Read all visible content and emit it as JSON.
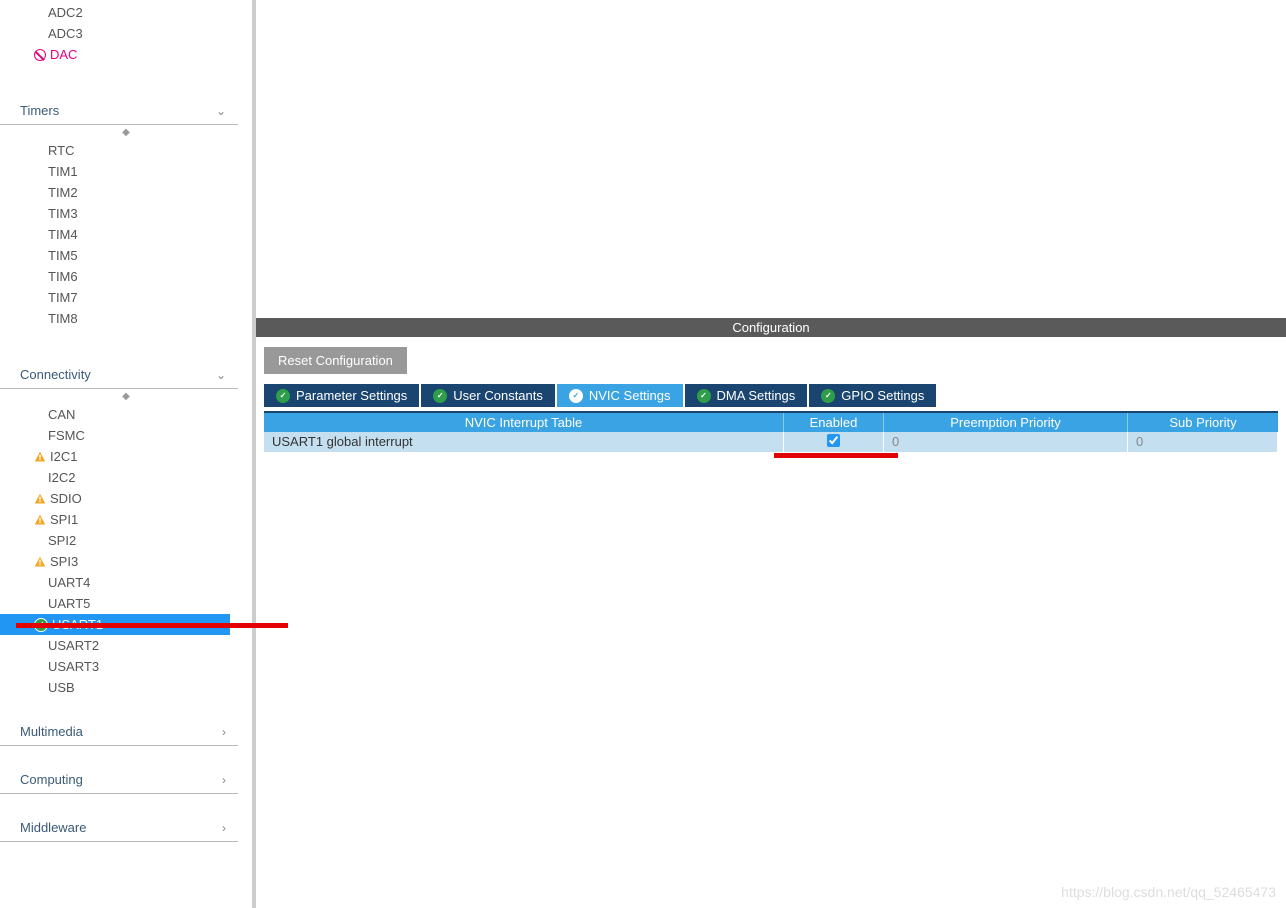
{
  "sidebar": {
    "analog_items": [
      "ADC2",
      "ADC3"
    ],
    "analog_disabled": "DAC",
    "sections": {
      "timers": {
        "label": "Timers",
        "items": [
          "RTC",
          "TIM1",
          "TIM2",
          "TIM3",
          "TIM4",
          "TIM5",
          "TIM6",
          "TIM7",
          "TIM8"
        ]
      },
      "connectivity": {
        "label": "Connectivity",
        "items": [
          {
            "label": "CAN",
            "icon": null
          },
          {
            "label": "FSMC",
            "icon": null
          },
          {
            "label": "I2C1",
            "icon": "warn"
          },
          {
            "label": "I2C2",
            "icon": null
          },
          {
            "label": "SDIO",
            "icon": "warn"
          },
          {
            "label": "SPI1",
            "icon": "warn"
          },
          {
            "label": "SPI2",
            "icon": null
          },
          {
            "label": "SPI3",
            "icon": "warn"
          },
          {
            "label": "UART4",
            "icon": null
          },
          {
            "label": "UART5",
            "icon": null
          },
          {
            "label": "USART1",
            "icon": "ok",
            "selected": true
          },
          {
            "label": "USART2",
            "icon": null
          },
          {
            "label": "USART3",
            "icon": null
          },
          {
            "label": "USB",
            "icon": null
          }
        ]
      },
      "multimedia": {
        "label": "Multimedia"
      },
      "computing": {
        "label": "Computing"
      },
      "middleware": {
        "label": "Middleware"
      }
    }
  },
  "config": {
    "header": "Configuration",
    "reset_btn": "Reset Configuration",
    "tabs": [
      "Parameter Settings",
      "User Constants",
      "NVIC Settings",
      "DMA Settings",
      "GPIO Settings"
    ],
    "active_tab": 2,
    "table": {
      "headers": [
        "NVIC Interrupt Table",
        "Enabled",
        "Preemption Priority",
        "Sub Priority"
      ],
      "rows": [
        {
          "name": "USART1 global interrupt",
          "enabled": true,
          "preemption": "0",
          "sub": "0"
        }
      ]
    }
  },
  "watermark": "https://blog.csdn.net/qq_52465473"
}
